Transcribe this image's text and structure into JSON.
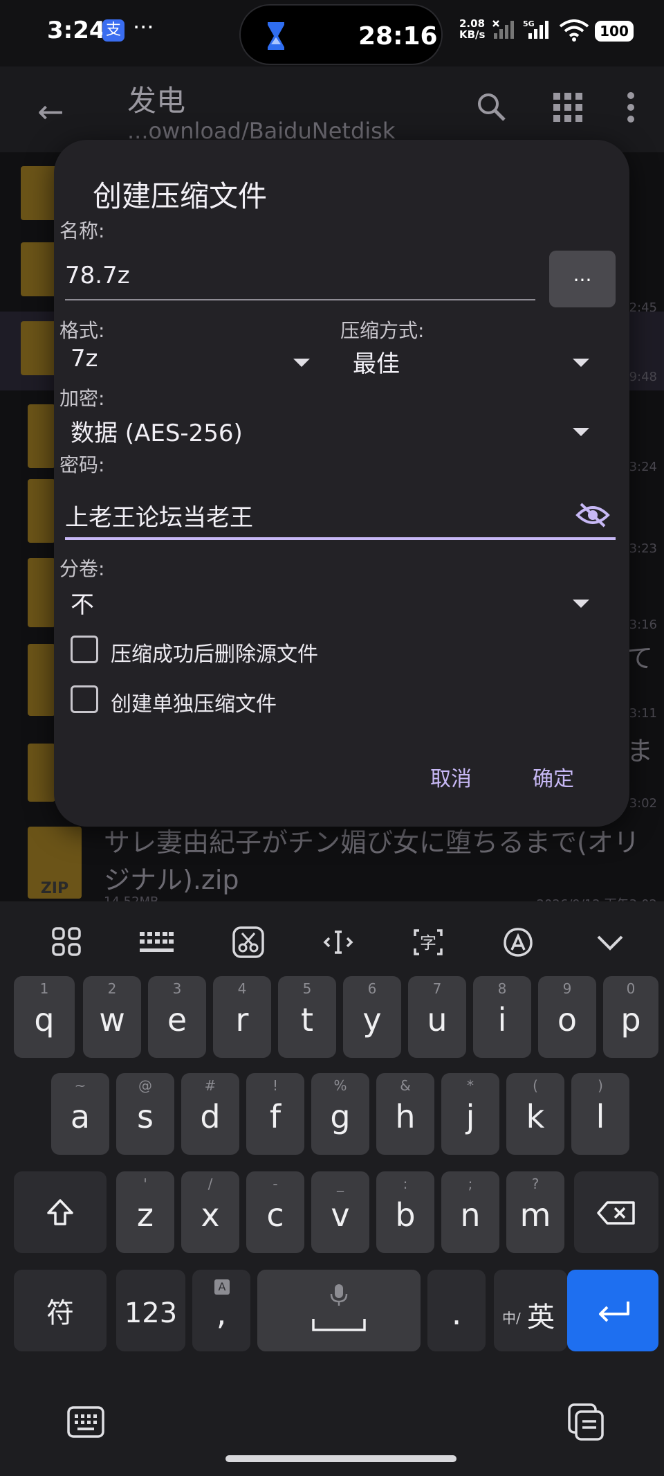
{
  "status": {
    "time": "3:24",
    "app_badge": "支",
    "more": "···",
    "timer": "28:16",
    "net_speed_value": "2.08",
    "net_speed_unit": "KB/s",
    "net_type": "5G",
    "battery": "100"
  },
  "appbar": {
    "title": "发电",
    "path": "...ownload/BaiduNetdisk"
  },
  "background_list": {
    "times": [
      "2:45",
      "9:48",
      "3:24",
      "3:23",
      "3:16",
      "3:11",
      "3:02"
    ],
    "snippets": [
      "て",
      "ま"
    ],
    "zip_label": "ZIP",
    "last_file_name": "サレ妻由紀子がチン媚び女に堕ちるまで(オリジナル).zip",
    "last_file_size": "14.52MB",
    "last_file_date": "2026/9/12 下午3:02"
  },
  "dialog": {
    "title": "创建压缩文件",
    "name_label": "名称:",
    "name_value": "78.7z",
    "browse_label": "...",
    "format_label": "格式:",
    "format_value": "7z",
    "method_label": "压缩方式:",
    "method_value": "最佳",
    "encrypt_label": "加密:",
    "encrypt_value": "数据 (AES-256)",
    "password_label": "密码:",
    "password_value": "上老王论坛当老王",
    "split_label": "分卷:",
    "split_value": "不",
    "delete_source_label": "压缩成功后删除源文件",
    "delete_source_checked": false,
    "separate_archive_label": "创建单独压缩文件",
    "separate_archive_checked": false,
    "cancel_label": "取消",
    "ok_label": "确定",
    "accent_color": "#c7b8f5"
  },
  "keyboard": {
    "toolbar_icons": [
      "apps-grid-icon",
      "keyboard-layout-icon",
      "scissors-icon",
      "text-cursor-icon",
      "translate-icon",
      "handwriting-icon",
      "collapse-chevron-icon"
    ],
    "row1": [
      {
        "k": "q",
        "h": "1"
      },
      {
        "k": "w",
        "h": "2"
      },
      {
        "k": "e",
        "h": "3"
      },
      {
        "k": "r",
        "h": "4"
      },
      {
        "k": "t",
        "h": "5"
      },
      {
        "k": "y",
        "h": "6"
      },
      {
        "k": "u",
        "h": "7"
      },
      {
        "k": "i",
        "h": "8"
      },
      {
        "k": "o",
        "h": "9"
      },
      {
        "k": "p",
        "h": "0"
      }
    ],
    "row2": [
      {
        "k": "a",
        "h": "~"
      },
      {
        "k": "s",
        "h": "@"
      },
      {
        "k": "d",
        "h": "#"
      },
      {
        "k": "f",
        "h": "!"
      },
      {
        "k": "g",
        "h": "%"
      },
      {
        "k": "h",
        "h": "&"
      },
      {
        "k": "j",
        "h": "*"
      },
      {
        "k": "k",
        "h": "("
      },
      {
        "k": "l",
        "h": ")"
      }
    ],
    "row3": [
      {
        "k": "z",
        "h": "'"
      },
      {
        "k": "x",
        "h": "/"
      },
      {
        "k": "c",
        "h": "-"
      },
      {
        "k": "v",
        "h": "_"
      },
      {
        "k": "b",
        "h": ":"
      },
      {
        "k": "n",
        "h": ";"
      },
      {
        "k": "m",
        "h": "?"
      }
    ],
    "symbol_label": "符",
    "num_label": "123",
    "comma_label": ",",
    "comma_hint": "A",
    "period_label": ".",
    "lang_small": "中/",
    "lang_label": "英",
    "enter_color": "#1e6ff0"
  }
}
